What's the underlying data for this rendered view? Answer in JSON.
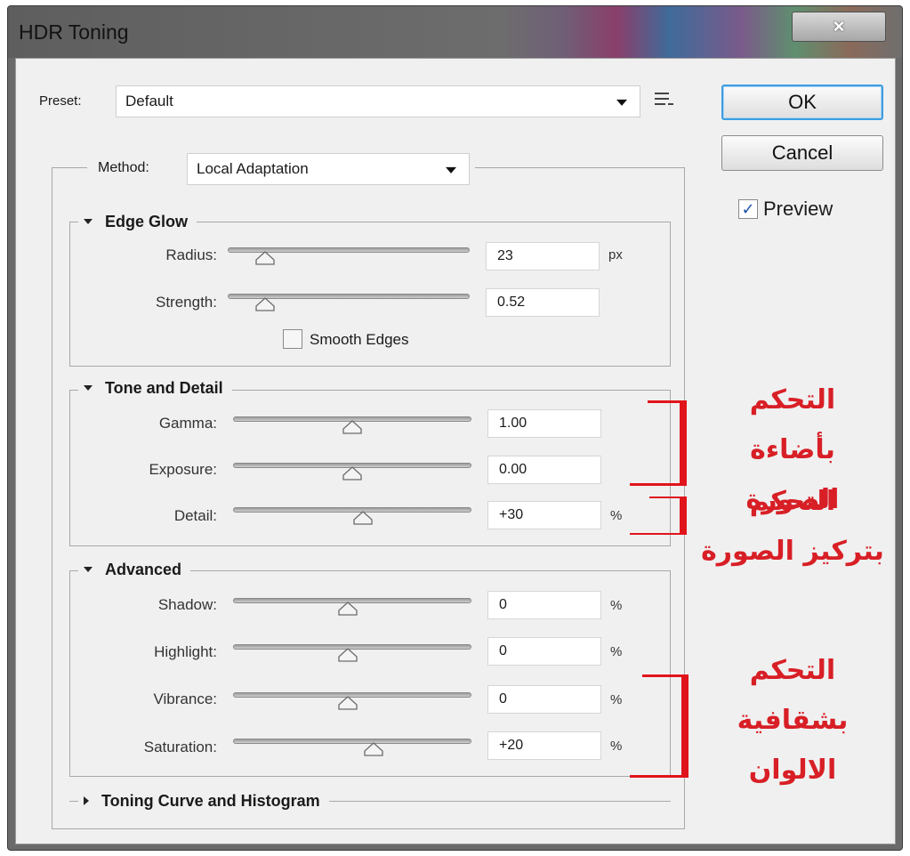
{
  "window": {
    "title": "HDR Toning",
    "close_glyph": "×"
  },
  "preset": {
    "label": "Preset:",
    "value": "Default"
  },
  "buttons": {
    "ok": "OK",
    "cancel": "Cancel"
  },
  "preview": {
    "label": "Preview",
    "checked": true,
    "check_glyph": "✓"
  },
  "method": {
    "label": "Method:",
    "value": "Local Adaptation"
  },
  "edge_glow": {
    "title": "Edge Glow",
    "radius": {
      "label": "Radius:",
      "value": "23",
      "unit": "px",
      "fraction": 0.12
    },
    "strength": {
      "label": "Strength:",
      "value": "0.52",
      "fraction": 0.12
    },
    "smooth_edges": {
      "label": "Smooth Edges",
      "checked": false
    }
  },
  "tone_detail": {
    "title": "Tone and Detail",
    "gamma": {
      "label": "Gamma:",
      "value": "1.00",
      "fraction": 0.5
    },
    "exposure": {
      "label": "Exposure:",
      "value": "0.00",
      "fraction": 0.5
    },
    "detail": {
      "label": "Detail:",
      "value": "+30",
      "unit": "%",
      "fraction": 0.55
    }
  },
  "advanced": {
    "title": "Advanced",
    "shadow": {
      "label": "Shadow:",
      "value": "0",
      "unit": "%",
      "fraction": 0.48
    },
    "highlight": {
      "label": "Highlight:",
      "value": "0",
      "unit": "%",
      "fraction": 0.48
    },
    "vibrance": {
      "label": "Vibrance:",
      "value": "0",
      "unit": "%",
      "fraction": 0.48
    },
    "saturation": {
      "label": "Saturation:",
      "value": "+20",
      "unit": "%",
      "fraction": 0.6
    }
  },
  "toning_curve": {
    "title": "Toning Curve and Histogram"
  },
  "annotations": {
    "brightness": [
      "التحكم",
      "بأضاءة الصورة"
    ],
    "focus": [
      "التحكم",
      "بتركيز الصورة"
    ],
    "colors": [
      "التحكم",
      "بشقافية",
      "الالوان"
    ]
  },
  "colors": {
    "annotation": "#d81f26",
    "ok_border": "#3d9de0",
    "check": "#1d4fa6"
  }
}
